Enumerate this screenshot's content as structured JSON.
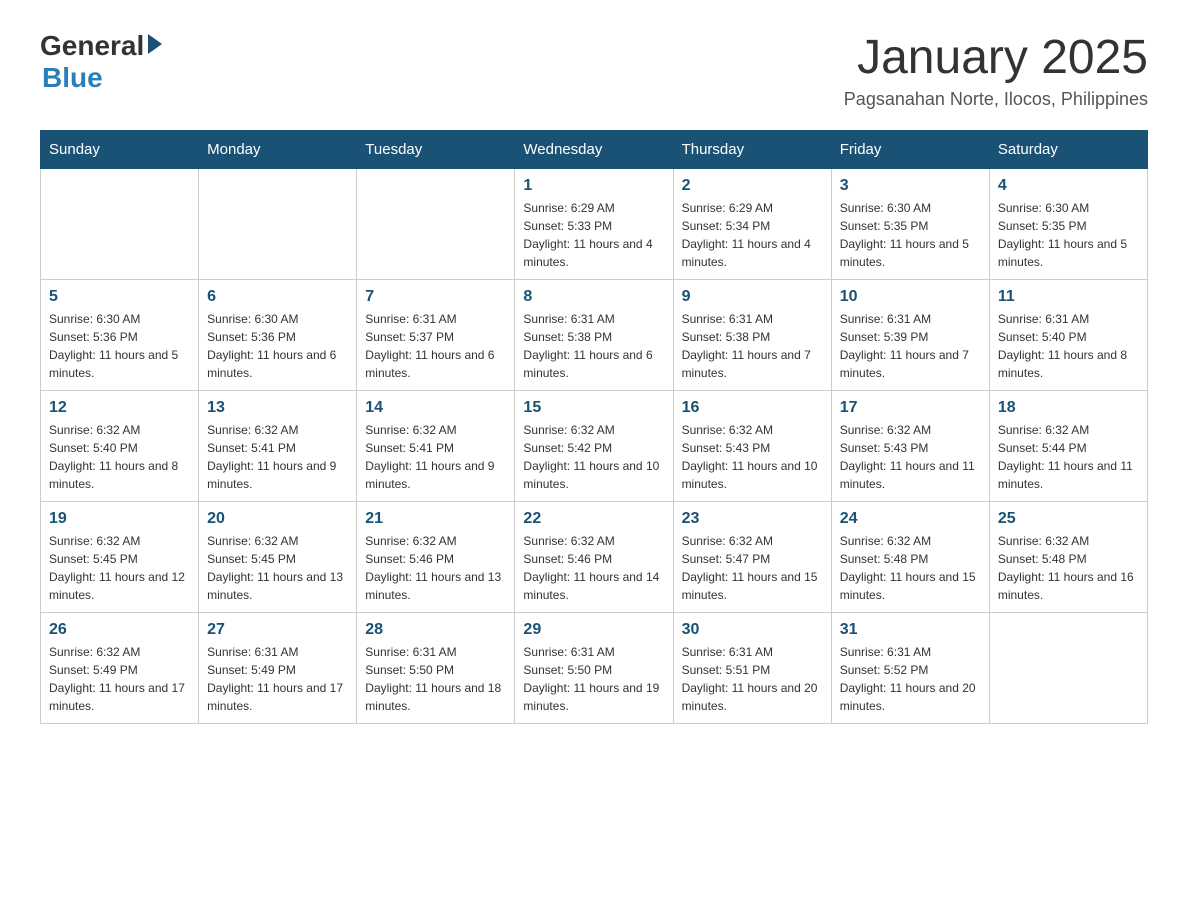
{
  "header": {
    "logo_general": "General",
    "logo_blue": "Blue",
    "month_year": "January 2025",
    "location": "Pagsanahan Norte, Ilocos, Philippines"
  },
  "days_of_week": [
    "Sunday",
    "Monday",
    "Tuesday",
    "Wednesday",
    "Thursday",
    "Friday",
    "Saturday"
  ],
  "weeks": [
    [
      {
        "day": "",
        "info": ""
      },
      {
        "day": "",
        "info": ""
      },
      {
        "day": "",
        "info": ""
      },
      {
        "day": "1",
        "info": "Sunrise: 6:29 AM\nSunset: 5:33 PM\nDaylight: 11 hours and 4 minutes."
      },
      {
        "day": "2",
        "info": "Sunrise: 6:29 AM\nSunset: 5:34 PM\nDaylight: 11 hours and 4 minutes."
      },
      {
        "day": "3",
        "info": "Sunrise: 6:30 AM\nSunset: 5:35 PM\nDaylight: 11 hours and 5 minutes."
      },
      {
        "day": "4",
        "info": "Sunrise: 6:30 AM\nSunset: 5:35 PM\nDaylight: 11 hours and 5 minutes."
      }
    ],
    [
      {
        "day": "5",
        "info": "Sunrise: 6:30 AM\nSunset: 5:36 PM\nDaylight: 11 hours and 5 minutes."
      },
      {
        "day": "6",
        "info": "Sunrise: 6:30 AM\nSunset: 5:36 PM\nDaylight: 11 hours and 6 minutes."
      },
      {
        "day": "7",
        "info": "Sunrise: 6:31 AM\nSunset: 5:37 PM\nDaylight: 11 hours and 6 minutes."
      },
      {
        "day": "8",
        "info": "Sunrise: 6:31 AM\nSunset: 5:38 PM\nDaylight: 11 hours and 6 minutes."
      },
      {
        "day": "9",
        "info": "Sunrise: 6:31 AM\nSunset: 5:38 PM\nDaylight: 11 hours and 7 minutes."
      },
      {
        "day": "10",
        "info": "Sunrise: 6:31 AM\nSunset: 5:39 PM\nDaylight: 11 hours and 7 minutes."
      },
      {
        "day": "11",
        "info": "Sunrise: 6:31 AM\nSunset: 5:40 PM\nDaylight: 11 hours and 8 minutes."
      }
    ],
    [
      {
        "day": "12",
        "info": "Sunrise: 6:32 AM\nSunset: 5:40 PM\nDaylight: 11 hours and 8 minutes."
      },
      {
        "day": "13",
        "info": "Sunrise: 6:32 AM\nSunset: 5:41 PM\nDaylight: 11 hours and 9 minutes."
      },
      {
        "day": "14",
        "info": "Sunrise: 6:32 AM\nSunset: 5:41 PM\nDaylight: 11 hours and 9 minutes."
      },
      {
        "day": "15",
        "info": "Sunrise: 6:32 AM\nSunset: 5:42 PM\nDaylight: 11 hours and 10 minutes."
      },
      {
        "day": "16",
        "info": "Sunrise: 6:32 AM\nSunset: 5:43 PM\nDaylight: 11 hours and 10 minutes."
      },
      {
        "day": "17",
        "info": "Sunrise: 6:32 AM\nSunset: 5:43 PM\nDaylight: 11 hours and 11 minutes."
      },
      {
        "day": "18",
        "info": "Sunrise: 6:32 AM\nSunset: 5:44 PM\nDaylight: 11 hours and 11 minutes."
      }
    ],
    [
      {
        "day": "19",
        "info": "Sunrise: 6:32 AM\nSunset: 5:45 PM\nDaylight: 11 hours and 12 minutes."
      },
      {
        "day": "20",
        "info": "Sunrise: 6:32 AM\nSunset: 5:45 PM\nDaylight: 11 hours and 13 minutes."
      },
      {
        "day": "21",
        "info": "Sunrise: 6:32 AM\nSunset: 5:46 PM\nDaylight: 11 hours and 13 minutes."
      },
      {
        "day": "22",
        "info": "Sunrise: 6:32 AM\nSunset: 5:46 PM\nDaylight: 11 hours and 14 minutes."
      },
      {
        "day": "23",
        "info": "Sunrise: 6:32 AM\nSunset: 5:47 PM\nDaylight: 11 hours and 15 minutes."
      },
      {
        "day": "24",
        "info": "Sunrise: 6:32 AM\nSunset: 5:48 PM\nDaylight: 11 hours and 15 minutes."
      },
      {
        "day": "25",
        "info": "Sunrise: 6:32 AM\nSunset: 5:48 PM\nDaylight: 11 hours and 16 minutes."
      }
    ],
    [
      {
        "day": "26",
        "info": "Sunrise: 6:32 AM\nSunset: 5:49 PM\nDaylight: 11 hours and 17 minutes."
      },
      {
        "day": "27",
        "info": "Sunrise: 6:31 AM\nSunset: 5:49 PM\nDaylight: 11 hours and 17 minutes."
      },
      {
        "day": "28",
        "info": "Sunrise: 6:31 AM\nSunset: 5:50 PM\nDaylight: 11 hours and 18 minutes."
      },
      {
        "day": "29",
        "info": "Sunrise: 6:31 AM\nSunset: 5:50 PM\nDaylight: 11 hours and 19 minutes."
      },
      {
        "day": "30",
        "info": "Sunrise: 6:31 AM\nSunset: 5:51 PM\nDaylight: 11 hours and 20 minutes."
      },
      {
        "day": "31",
        "info": "Sunrise: 6:31 AM\nSunset: 5:52 PM\nDaylight: 11 hours and 20 minutes."
      },
      {
        "day": "",
        "info": ""
      }
    ]
  ]
}
